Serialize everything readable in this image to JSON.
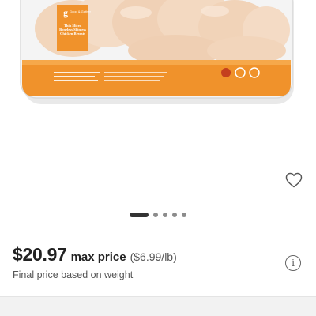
{
  "product": {
    "brand_logo_letter": "g",
    "brand_name": "Good & Gather",
    "product_label": "Thin Sliced Boneless Skinless Chicken Breasts",
    "image_colors": {
      "package_orange": "#f0922b",
      "chicken": "#f3d7bd"
    }
  },
  "gallery": {
    "dot_count": 5,
    "active_index": 0
  },
  "pricing": {
    "price": "$20.97",
    "max_label": "max price",
    "unit_price": "($6.99/lb)",
    "note": "Final price based on weight",
    "info_glyph": "i"
  },
  "icons": {
    "favorite": "heart-outline-icon",
    "info": "info-circle-icon"
  }
}
